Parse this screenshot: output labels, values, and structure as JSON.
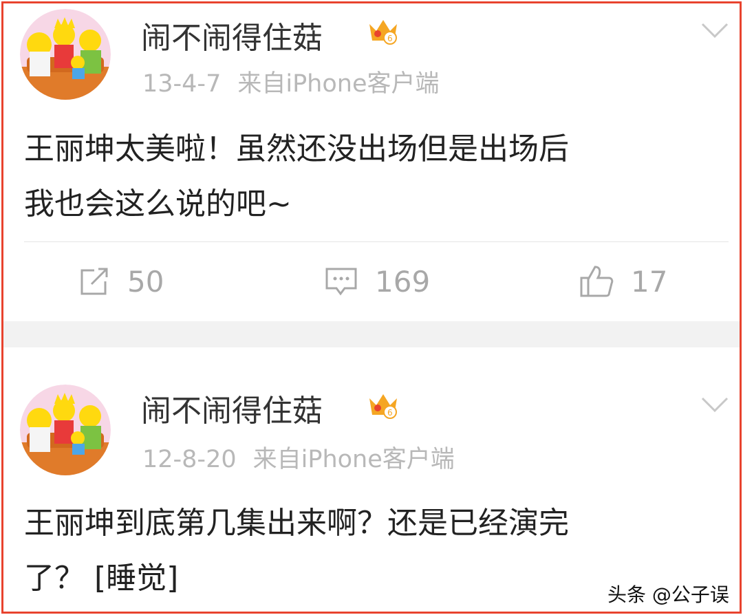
{
  "posts": [
    {
      "username": "闹不闹得住菇",
      "date": "13-4-7",
      "source": "来自iPhone客户端",
      "content_line1": "王丽坤太美啦！虽然还没出场但是出场后",
      "content_line2": "我也会这么说的吧~",
      "reposts": "50",
      "comments": "169",
      "likes": "17"
    },
    {
      "username": "闹不闹得住菇",
      "date": "12-8-20",
      "source": "来自iPhone客户端",
      "content_line1": "王丽坤到底第几集出来啊？还是已经演完",
      "content_line2": "了？ [睡觉]"
    }
  ],
  "watermark": "头条 @公子误",
  "colors": {
    "frame_border": "#e8432e",
    "meta_text": "#b8b8b8",
    "action_text": "#a8a8a8",
    "crown": "#f5a623",
    "separator_bg": "#f2f2f2"
  },
  "icons": [
    "avatar-cartoon-family",
    "crown-badge-icon",
    "chevron-down-icon",
    "repost-icon",
    "comment-icon",
    "thumbs-up-icon"
  ]
}
